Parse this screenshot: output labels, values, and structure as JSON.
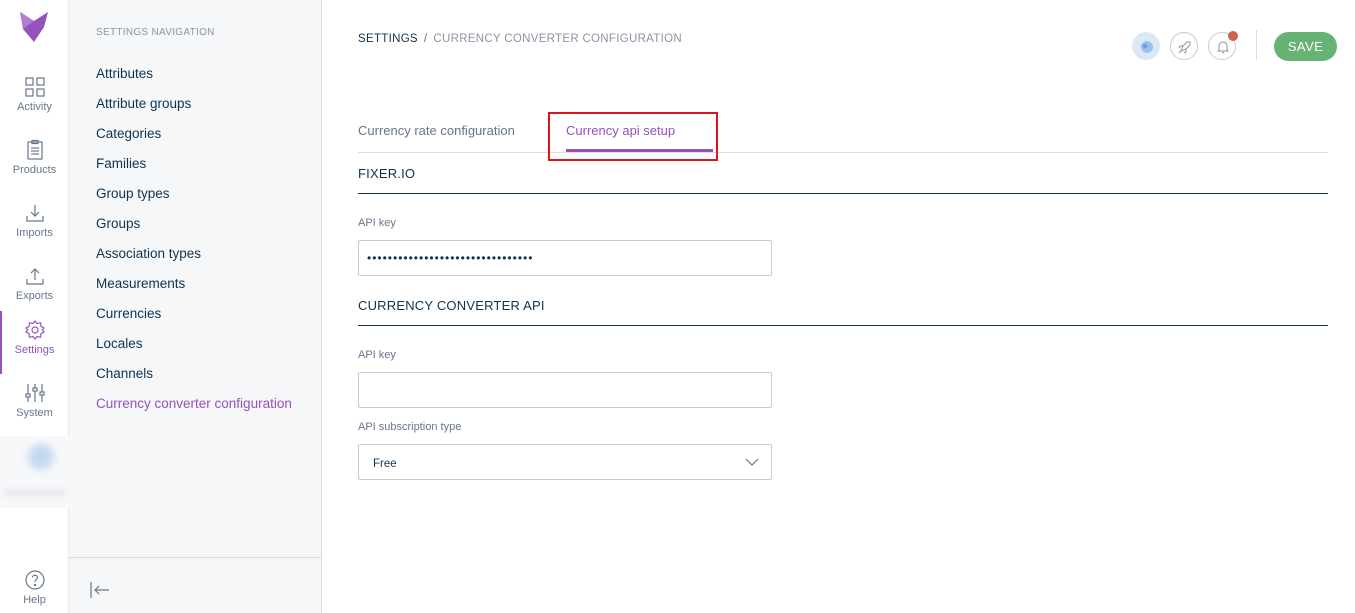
{
  "main_menu": {
    "items": [
      {
        "label": "Activity",
        "icon": "activity-icon"
      },
      {
        "label": "Products",
        "icon": "products-icon"
      },
      {
        "label": "Imports",
        "icon": "imports-icon"
      },
      {
        "label": "Exports",
        "icon": "exports-icon"
      },
      {
        "label": "Settings",
        "icon": "settings-icon",
        "active": true
      },
      {
        "label": "System",
        "icon": "system-icon"
      }
    ],
    "help_label": "Help"
  },
  "settings_nav": {
    "title": "SETTINGS NAVIGATION",
    "items": [
      "Attributes",
      "Attribute groups",
      "Categories",
      "Families",
      "Group types",
      "Groups",
      "Association types",
      "Measurements",
      "Currencies",
      "Locales",
      "Channels",
      "Currency converter configuration"
    ],
    "active_index": 11
  },
  "breadcrumb": {
    "root": "SETTINGS",
    "separator": "/",
    "current": "CURRENCY CONVERTER CONFIGURATION"
  },
  "header": {
    "save_label": "SAVE"
  },
  "tabs": [
    {
      "label": "Currency rate configuration",
      "active": false
    },
    {
      "label": "Currency api setup",
      "active": true
    }
  ],
  "fixer": {
    "section_title": "FIXER.IO",
    "api_key_label": "API key",
    "api_key_value": "••••••••••••••••••••••••••••••••"
  },
  "converter_api": {
    "section_title": "CURRENCY CONVERTER API",
    "api_key_label": "API key",
    "api_key_value": "",
    "subscription_label": "API subscription type",
    "subscription_value": "Free"
  },
  "colors": {
    "accent": "#9452ba",
    "save_button": "#67b373",
    "highlight_box": "#d7161f",
    "notification_dot": "#d4604f"
  }
}
